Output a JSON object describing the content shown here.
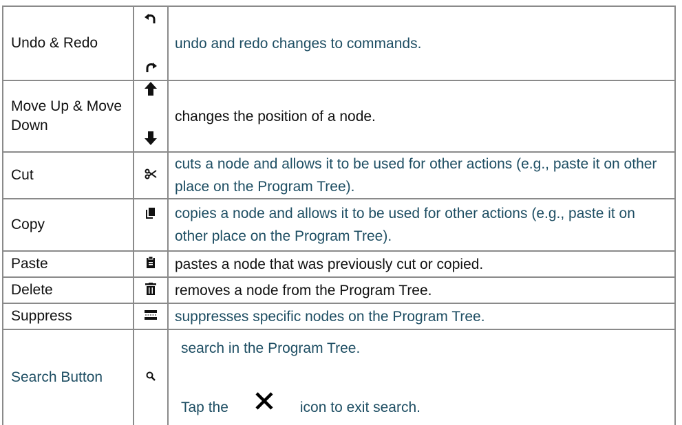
{
  "rows": [
    {
      "name": "Undo & Redo",
      "icons": [
        "undo-icon",
        "redo-icon"
      ],
      "desc": "undo and redo changes to commands."
    },
    {
      "name": "Move Up & Move Down",
      "icons": [
        "arrow-up-icon",
        "arrow-down-icon"
      ],
      "desc": "changes the position of a node."
    },
    {
      "name": "Cut",
      "icons": [
        "scissors-icon"
      ],
      "desc": "cuts a node and allows it to be used for other actions (e.g., paste it on other place on the Program Tree)."
    },
    {
      "name": "Copy",
      "icons": [
        "copy-icon"
      ],
      "desc": "copies a node and allows it to be used for other actions (e.g., paste it on other place on the Program Tree)."
    },
    {
      "name": "Paste",
      "icons": [
        "clipboard-icon"
      ],
      "desc": "pastes a node that was previously cut or copied."
    },
    {
      "name": "Delete",
      "icons": [
        "trash-icon"
      ],
      "desc": "removes a node from the Program Tree."
    },
    {
      "name": "Suppress",
      "icons": [
        "suppress-icon"
      ],
      "desc": "suppresses specific nodes on the Program Tree."
    },
    {
      "name": "Search Button",
      "icons": [
        "search-icon",
        "close-icon"
      ],
      "desc": "search in the Program Tree.",
      "desc2_before": "Tap the",
      "desc2_after": "icon to exit search."
    }
  ]
}
